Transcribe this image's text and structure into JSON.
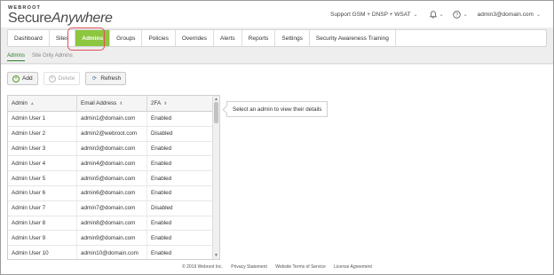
{
  "header": {
    "logo_small": "WEBROOT",
    "logo_main_1": "Secure",
    "logo_main_2": "Anywhere",
    "site_selector": "Support GSM + DNSP + WSAT",
    "user": "admin3@domain.com"
  },
  "nav": {
    "tabs": [
      "Dashboard",
      "Sites",
      "Admins",
      "Groups",
      "Policies",
      "Overrides",
      "Alerts",
      "Reports",
      "Settings",
      "Security Awareness Training"
    ],
    "active": "Admins"
  },
  "subtabs": [
    "Admins",
    "Site Only Admins"
  ],
  "toolbar": {
    "add": "Add",
    "delete": "Delete",
    "refresh": "Refresh"
  },
  "table": {
    "headers": [
      "Admin",
      "Email Address",
      "2FA"
    ],
    "rows": [
      [
        "Admin User 1",
        "admin1@domain.com",
        "Enabled"
      ],
      [
        "Admin User 2",
        "admin2@webroot.com",
        "Disabled"
      ],
      [
        "Admin User 3",
        "admin3@domain.com",
        "Enabled"
      ],
      [
        "Admin User 4",
        "admin4@domain.com",
        "Enabled"
      ],
      [
        "Admin User 5",
        "admin5@domain.com",
        "Enabled"
      ],
      [
        "Admin User 6",
        "admin6@domain.com",
        "Enabled"
      ],
      [
        "Admin User 7",
        "admin7@domain.com",
        "Disabled"
      ],
      [
        "Admin User 8",
        "admin8@domain.com",
        "Enabled"
      ],
      [
        "Admin User 9",
        "admin9@domain.com",
        "Enabled"
      ],
      [
        "Admin User 10",
        "admin10@domain.com",
        "Enabled"
      ]
    ]
  },
  "details": {
    "placeholder": "Select an admin to view their details"
  },
  "footer": {
    "copyright": "© 2019 Webroot Inc.",
    "links": [
      "Privacy Statement",
      "Website Terms of Service",
      "License Agreement"
    ]
  },
  "colors": {
    "accent": "#8dc63f",
    "highlight": "#e0505a"
  }
}
